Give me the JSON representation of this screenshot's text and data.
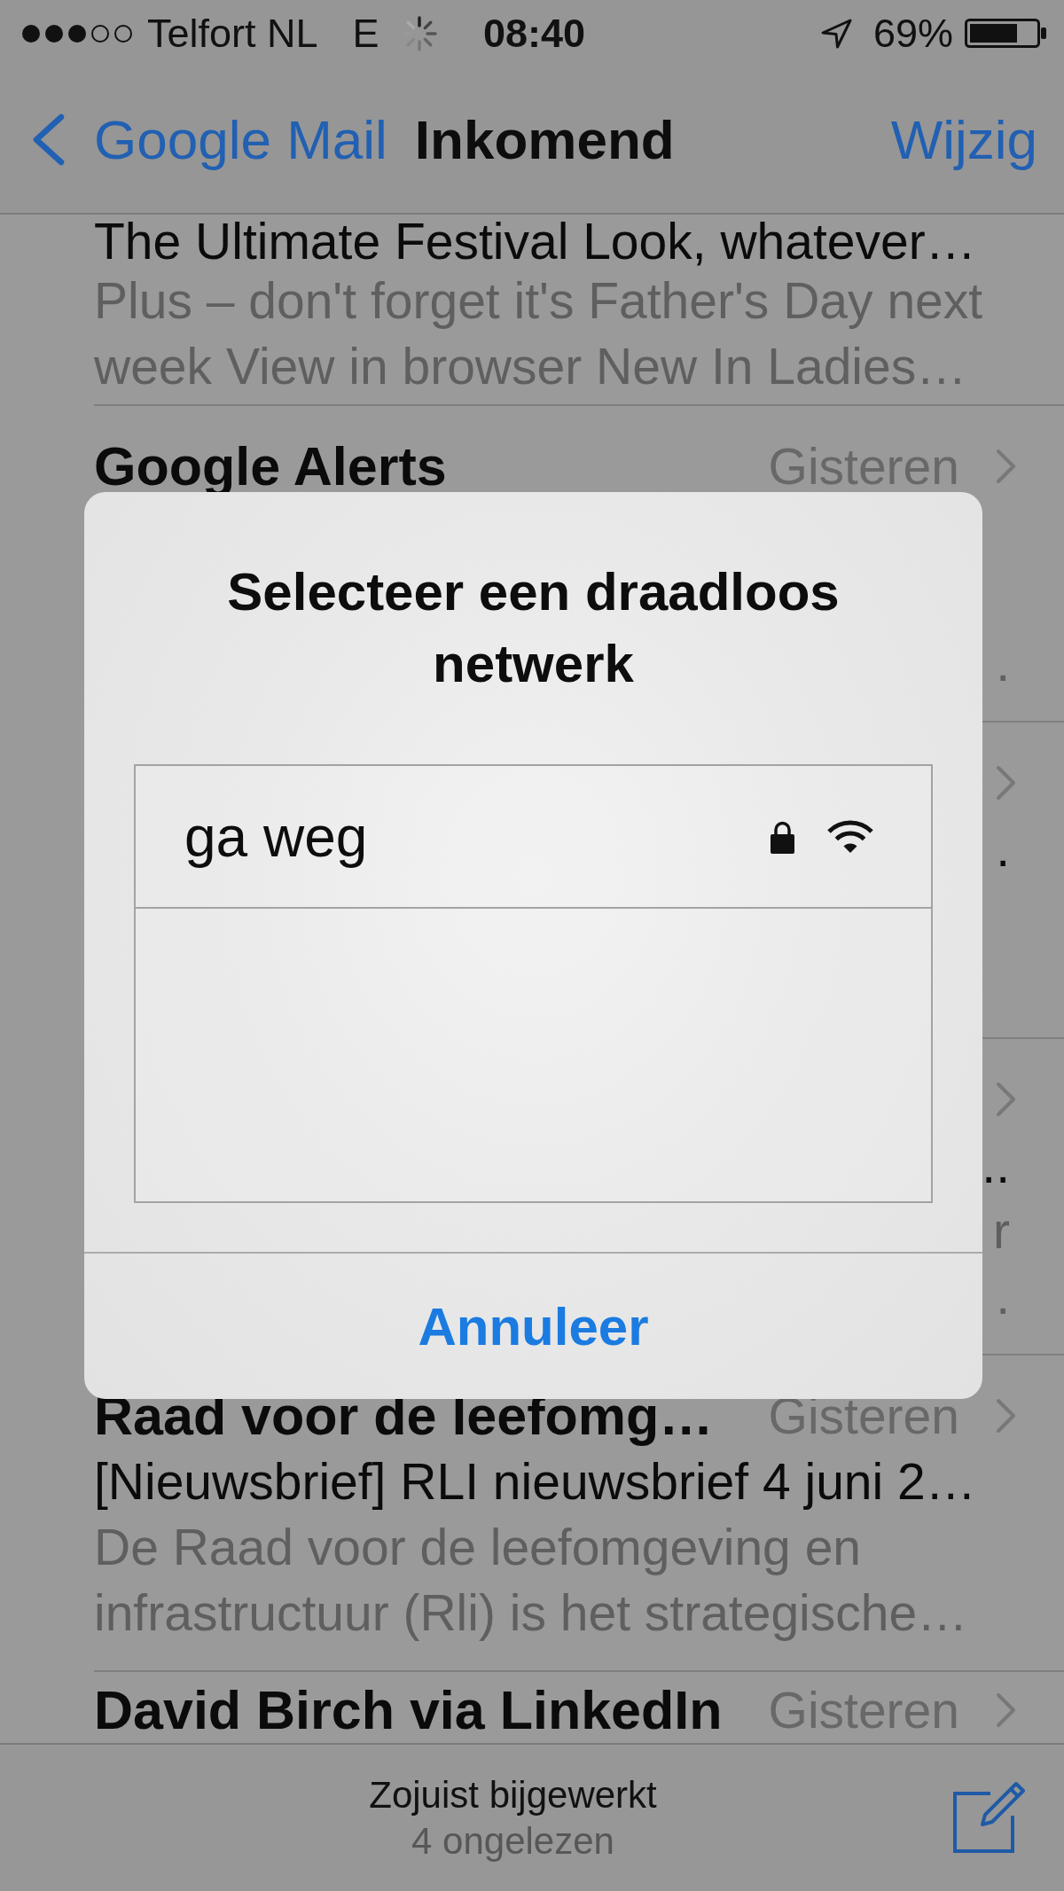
{
  "status_bar": {
    "carrier": "Telfort NL",
    "network": "E",
    "time": "08:40",
    "battery": "69%"
  },
  "nav_bar": {
    "back": "Google Mail",
    "title": "Inkomend",
    "action": "Wijzig"
  },
  "messages": [
    {
      "kind": "partial_top",
      "subject": "The Ultimate Festival Look, whatever…",
      "preview": "Plus – don't forget it's Father's Day next week View in browser New In Ladies…"
    },
    {
      "kind": "row",
      "sender": "Google Alerts",
      "date": "Gisteren",
      "preview_line_2_tail": "."
    },
    {
      "kind": "row",
      "subject_tail": "."
    },
    {
      "kind": "row",
      "subject_tail": "..",
      "preview_line_1_tail": "r",
      "preview_line_2_tail": "."
    },
    {
      "kind": "row",
      "sender": "Raad voor de leefomg…",
      "date": "Gisteren",
      "subject": "[Nieuwsbrief] RLI nieuwsbrief 4 juni 2…",
      "preview": "De Raad voor de leefomgeving en infrastructuur (Rli) is het strategische…"
    },
    {
      "kind": "partial_bottom",
      "sender": "David Birch via LinkedIn",
      "date": "Gisteren"
    }
  ],
  "dialog": {
    "title": "Selecteer een draadloos netwerk",
    "networks": [
      {
        "name": "ga weg",
        "secured": true
      }
    ],
    "button": "Annuleer"
  },
  "toolbar": {
    "status": "Zojuist bijgewerkt",
    "unread": "4 ongelezen"
  }
}
